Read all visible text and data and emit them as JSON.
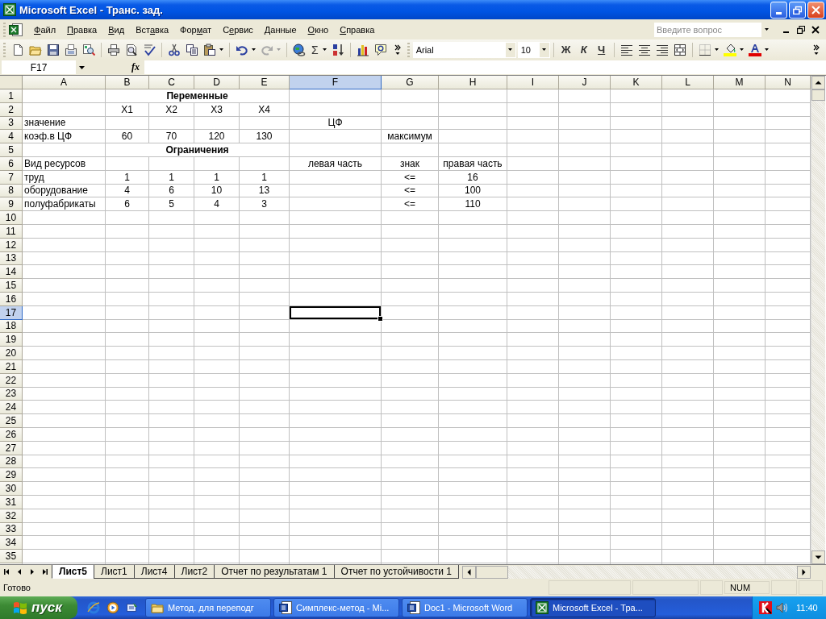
{
  "window": {
    "title": "Microsoft Excel - Транс. зад."
  },
  "menu": [
    {
      "key": "Ф",
      "post": "айл"
    },
    {
      "key": "П",
      "post": "равка"
    },
    {
      "key": "В",
      "post": "ид"
    },
    {
      "pre": "Вст",
      "key": "а",
      "post": "вка"
    },
    {
      "pre": "Фор",
      "key": "м",
      "post": "ат"
    },
    {
      "pre": "С",
      "key": "е",
      "post": "рвис"
    },
    {
      "key": "Д",
      "post": "анные"
    },
    {
      "key": "О",
      "post": "кно"
    },
    {
      "key": "С",
      "post": "правка"
    }
  ],
  "question_box": {
    "placeholder": "Введите вопрос"
  },
  "standard_toolbar": {
    "sum_symbol": "Σ"
  },
  "formatting_toolbar": {
    "font": "Arial",
    "size": "10",
    "style_buttons": [
      "Ж",
      "К",
      "Ч"
    ]
  },
  "formula_bar": {
    "name_box": "F17",
    "fx_label": "fx"
  },
  "sheet": {
    "columns": [
      {
        "label": "A",
        "selected": false
      },
      {
        "label": "B",
        "selected": false
      },
      {
        "label": "C",
        "selected": false
      },
      {
        "label": "D",
        "selected": false
      },
      {
        "label": "E",
        "selected": false
      },
      {
        "label": "F",
        "selected": true
      },
      {
        "label": "G",
        "selected": false
      },
      {
        "label": "H",
        "selected": false
      },
      {
        "label": "I",
        "selected": false
      },
      {
        "label": "J",
        "selected": false
      },
      {
        "label": "K",
        "selected": false
      },
      {
        "label": "L",
        "selected": false
      },
      {
        "label": "M",
        "selected": false
      },
      {
        "label": "N",
        "selected": false
      }
    ],
    "rows": [
      {
        "label": "1",
        "selected": false,
        "cells": {
          "B": {
            "text": "Переменные",
            "bold": true,
            "centered": true
          },
          "C": {
            "merged": true
          },
          "D": {
            "merged": true
          },
          "E": {
            "merged": true
          }
        }
      },
      {
        "label": "2",
        "selected": false,
        "cells": {
          "B": {
            "text": "X1",
            "centered": true
          },
          "C": {
            "text": "X2",
            "centered": true
          },
          "D": {
            "text": "X3",
            "centered": true
          },
          "E": {
            "text": "X4",
            "centered": true
          }
        }
      },
      {
        "label": "3",
        "selected": false,
        "cells": {
          "A": {
            "text": "значение"
          },
          "F": {
            "text": "ЦФ",
            "centered": true
          }
        }
      },
      {
        "label": "4",
        "selected": false,
        "cells": {
          "A": {
            "text": "коэф.в ЦФ"
          },
          "B": {
            "text": "60",
            "centered": true
          },
          "C": {
            "text": "70",
            "centered": true
          },
          "D": {
            "text": "120",
            "centered": true
          },
          "E": {
            "text": "130",
            "centered": true
          },
          "G": {
            "text": "максимум",
            "centered": true
          }
        }
      },
      {
        "label": "5",
        "selected": false,
        "cells": {
          "B": {
            "text": "Ограничения",
            "bold": true,
            "centered": true
          },
          "C": {
            "merged": true
          },
          "D": {
            "merged": true
          },
          "E": {
            "merged": true
          }
        }
      },
      {
        "label": "6",
        "selected": false,
        "cells": {
          "A": {
            "text": "Вид ресурсов"
          },
          "F": {
            "text": "левая часть",
            "centered": true
          },
          "G": {
            "text": "знак",
            "centered": true
          },
          "H": {
            "text": "правая часть",
            "centered": true
          }
        }
      },
      {
        "label": "7",
        "selected": false,
        "cells": {
          "A": {
            "text": "труд"
          },
          "B": {
            "text": "1",
            "centered": true
          },
          "C": {
            "text": "1",
            "centered": true
          },
          "D": {
            "text": "1",
            "centered": true
          },
          "E": {
            "text": "1",
            "centered": true
          },
          "G": {
            "text": "<=",
            "centered": true
          },
          "H": {
            "text": "16",
            "centered": true
          }
        }
      },
      {
        "label": "8",
        "selected": false,
        "cells": {
          "A": {
            "text": "оборудование"
          },
          "B": {
            "text": "4",
            "centered": true
          },
          "C": {
            "text": "6",
            "centered": true
          },
          "D": {
            "text": "10",
            "centered": true
          },
          "E": {
            "text": "13",
            "centered": true
          },
          "G": {
            "text": "<=",
            "centered": true
          },
          "H": {
            "text": "100",
            "centered": true
          }
        }
      },
      {
        "label": "9",
        "selected": false,
        "cells": {
          "A": {
            "text": "полуфабрикаты"
          },
          "B": {
            "text": "6",
            "centered": true
          },
          "C": {
            "text": "5",
            "centered": true
          },
          "D": {
            "text": "4",
            "centered": true
          },
          "E": {
            "text": "3",
            "centered": true
          },
          "G": {
            "text": "<=",
            "centered": true
          },
          "H": {
            "text": "110",
            "centered": true
          }
        }
      },
      {
        "label": "10",
        "selected": false
      },
      {
        "label": "11",
        "selected": false
      },
      {
        "label": "12",
        "selected": false
      },
      {
        "label": "13",
        "selected": false
      },
      {
        "label": "14",
        "selected": false
      },
      {
        "label": "15",
        "selected": false
      },
      {
        "label": "16",
        "selected": false
      },
      {
        "label": "17",
        "selected": true
      },
      {
        "label": "18",
        "selected": false
      },
      {
        "label": "19",
        "selected": false
      },
      {
        "label": "20",
        "selected": false
      },
      {
        "label": "21",
        "selected": false
      },
      {
        "label": "22",
        "selected": false
      },
      {
        "label": "23",
        "selected": false
      },
      {
        "label": "24",
        "selected": false
      },
      {
        "label": "25",
        "selected": false
      },
      {
        "label": "26",
        "selected": false
      },
      {
        "label": "27",
        "selected": false
      },
      {
        "label": "28",
        "selected": false
      },
      {
        "label": "29",
        "selected": false
      },
      {
        "label": "30",
        "selected": false
      },
      {
        "label": "31",
        "selected": false
      },
      {
        "label": "32",
        "selected": false
      },
      {
        "label": "33",
        "selected": false
      },
      {
        "label": "34",
        "selected": false
      },
      {
        "label": "35",
        "selected": false
      }
    ]
  },
  "sheet_tabs": [
    {
      "label": "Лист5",
      "selected": true
    },
    {
      "label": "Лист1",
      "selected": false
    },
    {
      "label": "Лист4",
      "selected": false
    },
    {
      "label": "Лист2",
      "selected": false
    },
    {
      "label": "Отчет по результатам 1",
      "selected": false
    },
    {
      "label": "Отчет по устойчивости 1",
      "selected": false
    }
  ],
  "status_bar": {
    "message": "Готово",
    "indicator": "NUM"
  },
  "taskbar": {
    "start_label": "пуск",
    "tasks": [
      {
        "kind": "folder",
        "label": "Метод. для переподг",
        "selected": false
      },
      {
        "kind": "word",
        "label": "Симплекс-метод - Mi...",
        "selected": false
      },
      {
        "kind": "word",
        "label": "Doc1 - Microsoft Word",
        "selected": false
      },
      {
        "kind": "excel",
        "label": "Microsoft Excel - Тра...",
        "selected": true
      }
    ],
    "clock": "11:40"
  }
}
